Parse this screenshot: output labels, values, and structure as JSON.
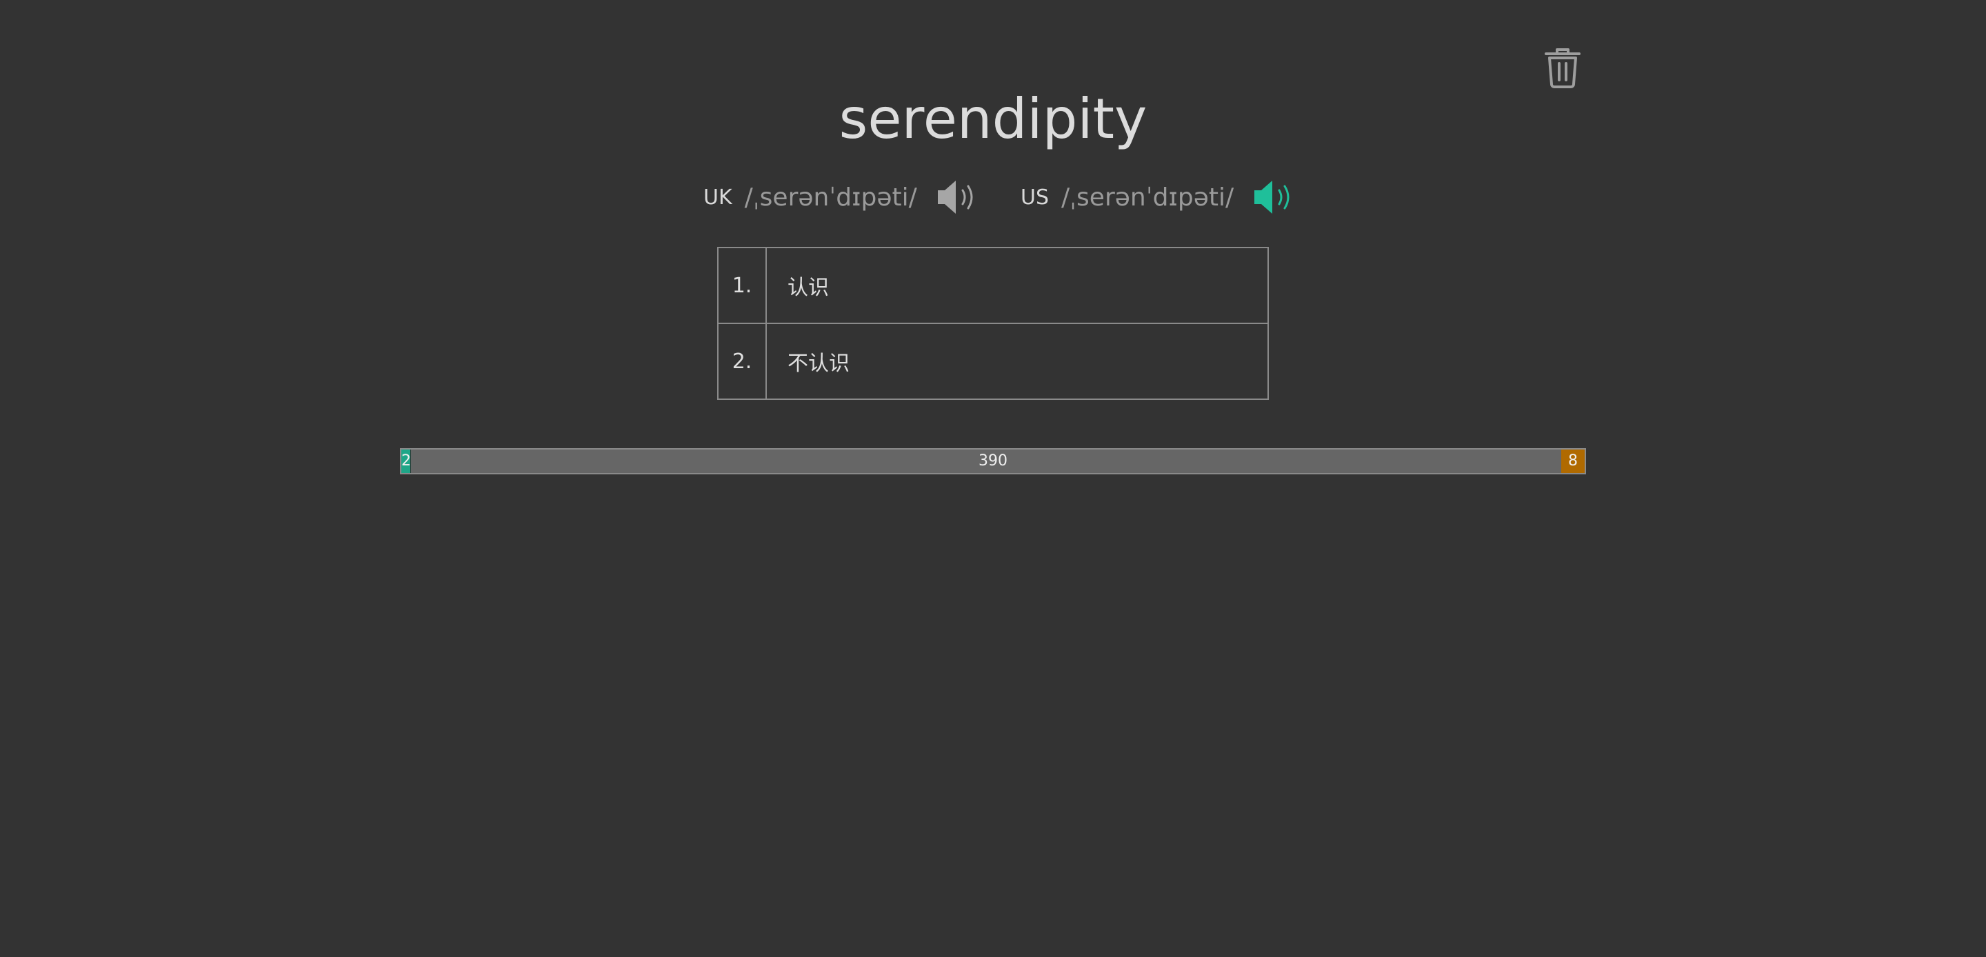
{
  "word": "serendipity",
  "pronunciations": {
    "uk": {
      "region": "UK",
      "ipa": "/ˌserənˈdɪpəti/",
      "speaker_icon": "speaker-icon",
      "speaker_color": "#a6a6a6"
    },
    "us": {
      "region": "US",
      "ipa": "/ˌserənˈdɪpəti/",
      "speaker_icon": "speaker-icon",
      "speaker_color": "#1fbf9a"
    }
  },
  "definitions": [
    {
      "num": "1.",
      "text": "认识"
    },
    {
      "num": "2.",
      "text": "不认识"
    }
  ],
  "progress": {
    "known": "2",
    "remaining": "390",
    "unknown": "8",
    "known_color": "#1fa688",
    "unknown_color": "#b06a00",
    "bar_color": "#666666"
  },
  "icons": {
    "delete": "trash-icon"
  }
}
